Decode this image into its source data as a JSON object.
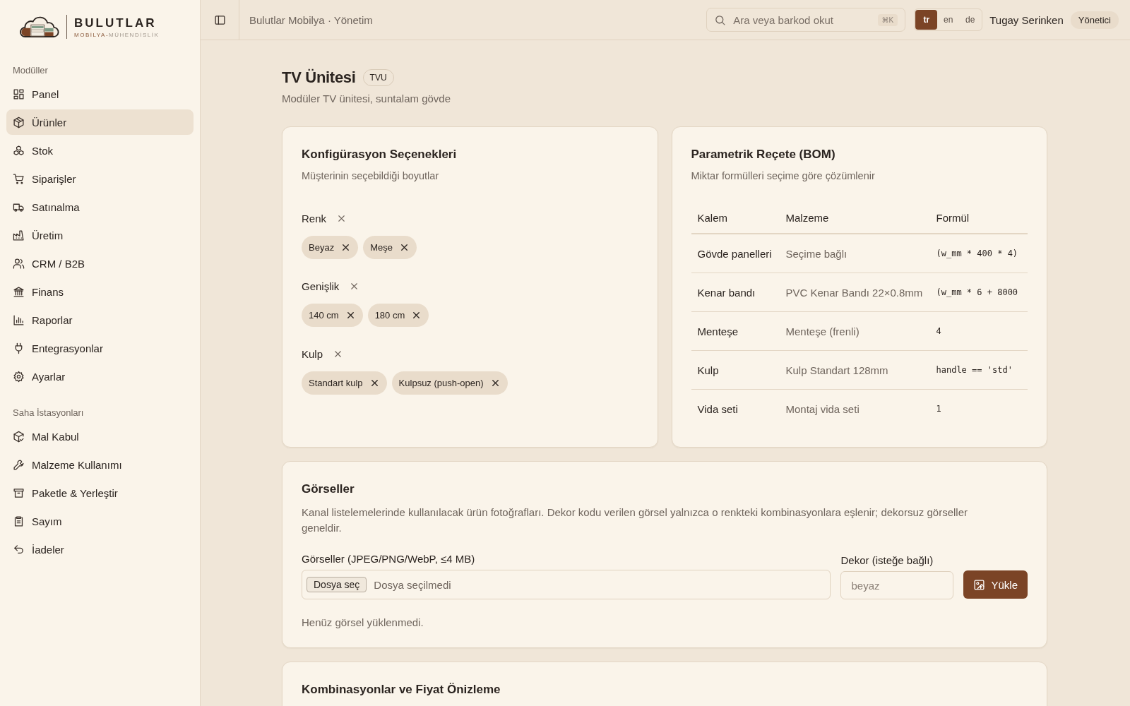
{
  "brand": {
    "name": "BULUTLAR",
    "tagline": [
      {
        "text": "MOBİLYA-",
        "accent": true
      },
      {
        "text": "MÜHENDİSLİK",
        "accent": false
      }
    ]
  },
  "sidebar": {
    "sections": [
      {
        "title": "Modüller",
        "items": [
          {
            "label": "Panel",
            "selected": false
          },
          {
            "label": "Ürünler",
            "selected": true
          },
          {
            "label": "Stok",
            "selected": false
          },
          {
            "label": "Siparişler",
            "selected": false
          },
          {
            "label": "Satınalma",
            "selected": false
          },
          {
            "label": "Üretim",
            "selected": false
          },
          {
            "label": "CRM / B2B",
            "selected": false
          },
          {
            "label": "Finans",
            "selected": false
          },
          {
            "label": "Raporlar",
            "selected": false
          },
          {
            "label": "Entegrasyonlar",
            "selected": false
          },
          {
            "label": "Ayarlar",
            "selected": false
          }
        ]
      },
      {
        "title": "Saha İstasyonları",
        "items": [
          {
            "label": "Mal Kabul",
            "selected": false
          },
          {
            "label": "Malzeme Kullanımı",
            "selected": false
          },
          {
            "label": "Paketle & Yerleştir",
            "selected": false
          },
          {
            "label": "Sayım",
            "selected": false
          },
          {
            "label": "İadeler",
            "selected": false
          }
        ]
      }
    ]
  },
  "header": {
    "breadcrumb": "Bulutlar Mobilya · Yönetim",
    "search": {
      "placeholder": "Ara veya barkod okut",
      "shortcut": "⌘K"
    },
    "languages": [
      {
        "label": "tr",
        "selected": true
      },
      {
        "label": "en",
        "selected": false
      },
      {
        "label": "de",
        "selected": false
      }
    ],
    "user": "Tugay Serinken",
    "role": "Yönetici"
  },
  "product": {
    "title": "TV Ünitesi",
    "code": "TVU",
    "subtitle": "Modüler TV ünitesi, suntalam gövde"
  },
  "config": {
    "title": "Konfigürasyon Seçenekleri",
    "subtitle": "Müşterinin seçebildiği boyutlar",
    "options": [
      {
        "name": "Renk",
        "values": [
          "Beyaz",
          "Meşe"
        ]
      },
      {
        "name": "Genişlik",
        "values": [
          "140 cm",
          "180 cm"
        ]
      },
      {
        "name": "Kulp",
        "values": [
          "Standart kulp",
          "Kulpsuz (push-open)"
        ]
      }
    ]
  },
  "bom": {
    "title": "Parametrik Reçete (BOM)",
    "subtitle": "Miktar formülleri seçime göre çözümlenir",
    "columns": [
      "Kalem",
      "Malzeme",
      "Formül"
    ],
    "rows": [
      [
        "Gövde panelleri",
        "Seçime bağlı",
        "(w_mm * 400 * 4)"
      ],
      [
        "Kenar bandı",
        "PVC Kenar Bandı 22×0.8mm",
        "(w_mm * 6 + 8000"
      ],
      [
        "Menteşe",
        "Menteşe (frenli)",
        "4"
      ],
      [
        "Kulp",
        "Kulp Standart 128mm",
        "handle == 'std'"
      ],
      [
        "Vida seti",
        "Montaj vida seti",
        "1"
      ]
    ]
  },
  "images": {
    "title": "Görseller",
    "description": "Kanal listelemelerinde kullanılacak ürün fotoğrafları. Dekor kodu verilen görsel yalnızca o renkteki kombinasyonlara eşlenir; dekorsuz görseller geneldir.",
    "file_label": "Görseller (JPEG/PNG/WebP, ≤4 MB)",
    "file_button": "Dosya seç",
    "file_status": "Dosya seçilmedi",
    "decor_label": "Dekor (isteğe bağlı)",
    "decor_placeholder": "beyaz",
    "upload_button": "Yükle",
    "empty_note": "Henüz görsel yüklenmedi."
  },
  "combinations": {
    "title": "Kombinasyonlar ve Fiyat Önizleme"
  }
}
